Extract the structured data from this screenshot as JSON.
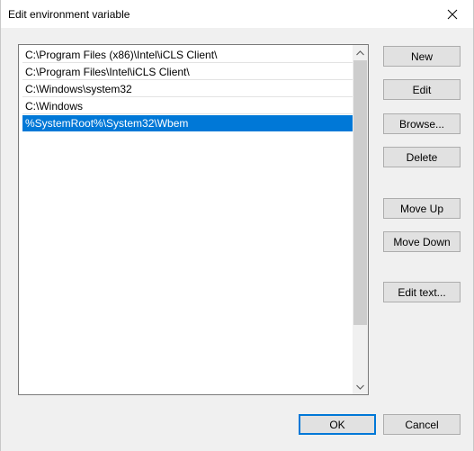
{
  "window": {
    "title": "Edit environment variable"
  },
  "list": {
    "items": [
      {
        "label": "C:\\Program Files (x86)\\Intel\\iCLS Client\\"
      },
      {
        "label": "C:\\Program Files\\Intel\\iCLS Client\\"
      },
      {
        "label": "C:\\Windows\\system32"
      },
      {
        "label": "C:\\Windows"
      },
      {
        "label": "%SystemRoot%\\System32\\Wbem"
      }
    ],
    "selected_index": 4
  },
  "buttons": {
    "new": "New",
    "edit": "Edit",
    "browse": "Browse...",
    "delete": "Delete",
    "move_up": "Move Up",
    "move_down": "Move Down",
    "edit_text": "Edit text...",
    "ok": "OK",
    "cancel": "Cancel"
  },
  "icons": {
    "close": "close-icon",
    "scroll_up": "chevron-up-icon",
    "scroll_down": "chevron-down-icon"
  },
  "colors": {
    "selection": "#0078d7",
    "default_button_border": "#0078d7"
  }
}
